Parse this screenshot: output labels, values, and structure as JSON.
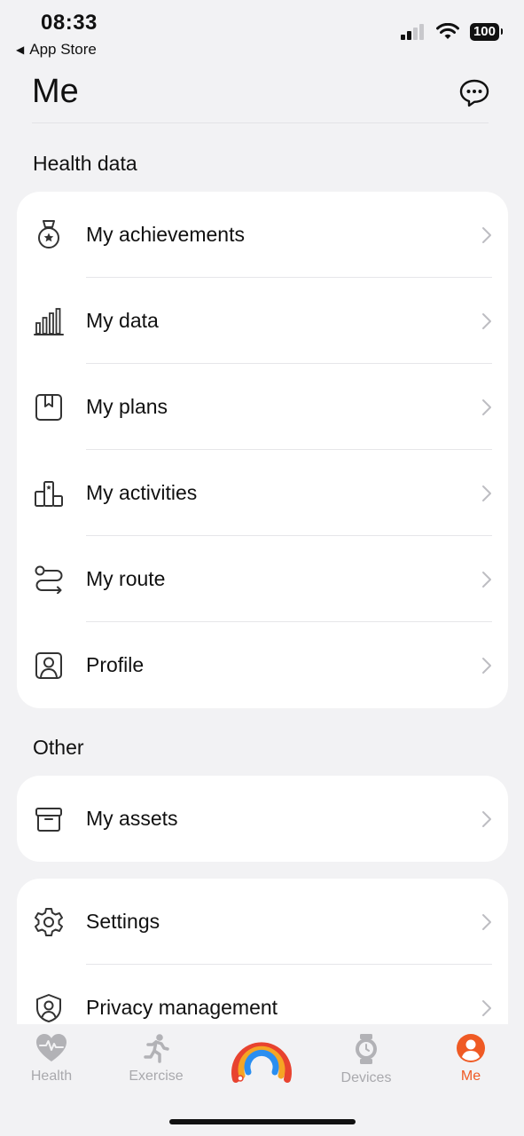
{
  "status_bar": {
    "time": "08:33",
    "back_app": "App Store",
    "battery": "100"
  },
  "header": {
    "title": "Me"
  },
  "sections": {
    "health": {
      "title": "Health data",
      "items": [
        {
          "label": "My achievements",
          "icon": "medal-icon"
        },
        {
          "label": "My data",
          "icon": "bar-chart-icon"
        },
        {
          "label": "My plans",
          "icon": "bookmark-icon"
        },
        {
          "label": "My activities",
          "icon": "podium-icon"
        },
        {
          "label": "My route",
          "icon": "route-icon"
        },
        {
          "label": "Profile",
          "icon": "profile-card-icon"
        }
      ]
    },
    "other": {
      "title": "Other",
      "items": [
        {
          "label": "My assets",
          "icon": "box-icon"
        }
      ]
    },
    "settings": {
      "items": [
        {
          "label": "Settings",
          "icon": "gear-icon"
        },
        {
          "label": "Privacy management",
          "icon": "shield-user-icon"
        }
      ]
    }
  },
  "tabbar": {
    "tabs": [
      {
        "label": "Health",
        "icon": "heart-icon"
      },
      {
        "label": "Exercise",
        "icon": "running-icon"
      },
      {
        "label": "",
        "icon": "rainbow-ring-icon"
      },
      {
        "label": "Devices",
        "icon": "watch-icon"
      },
      {
        "label": "Me",
        "icon": "person-icon"
      }
    ],
    "active_color": "#ef5a24",
    "inactive_color": "#a9a9ad"
  }
}
